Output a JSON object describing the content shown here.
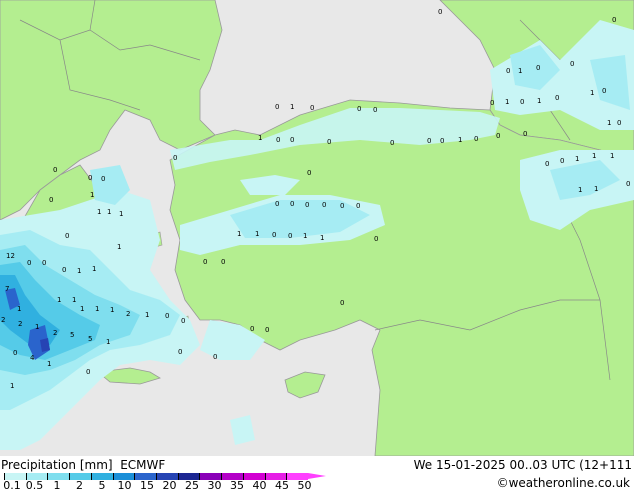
{
  "legend": {
    "title": "Precipitation [mm]",
    "model": "ECMWF",
    "ticks": [
      "0.1",
      "0.5",
      "1",
      "2",
      "5",
      "10",
      "15",
      "20",
      "25",
      "30",
      "35",
      "40",
      "45",
      "50"
    ],
    "colors": [
      "#c8f5f5",
      "#a6ecf3",
      "#7fdeee",
      "#55cbe8",
      "#30b0e0",
      "#1b8fd8",
      "#2a64cc",
      "#2644b4",
      "#1c2692",
      "#8a00b8",
      "#b400c8",
      "#d200d2",
      "#e61ee6",
      "#ff40ff"
    ]
  },
  "valid_time": "We 15-01-2025 00..03 UTC (12+111",
  "credit": "©weatheronline.co.uk",
  "map_labels": [
    "0",
    "1",
    "2",
    "4",
    "5",
    "7",
    "12"
  ],
  "colors": {
    "sea": "#e8e8e8",
    "land": "#b4ee90",
    "coast": "#999999",
    "border": "#888888"
  }
}
